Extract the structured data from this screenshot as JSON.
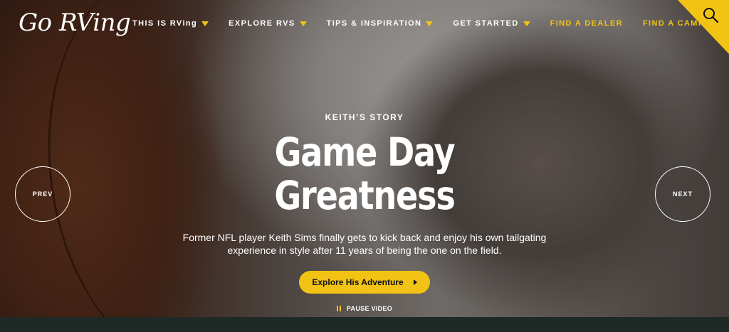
{
  "brand": {
    "logo_text": "Go RVing"
  },
  "nav": {
    "items": [
      {
        "label": "THIS IS RVing",
        "has_dropdown": true
      },
      {
        "label": "EXPLORE RVS",
        "has_dropdown": true
      },
      {
        "label": "TIPS & INSPIRATION",
        "has_dropdown": true
      },
      {
        "label": "GET STARTED",
        "has_dropdown": true
      },
      {
        "label": "FIND A DEALER",
        "has_dropdown": false
      },
      {
        "label": "FIND A CAMPGROUND",
        "has_dropdown": false
      }
    ]
  },
  "search": {
    "icon": "search-icon"
  },
  "hero": {
    "eyebrow": "KEITH’S STORY",
    "headline": "Game Day Greatness",
    "description": "Former NFL player Keith Sims finally gets to kick back and enjoy his own tailgating experience in style after 11 years of being the one on the field.",
    "cta_label": "Explore His Adventure",
    "pause_label": "PAUSE VIDEO"
  },
  "carousel": {
    "prev_label": "PREV",
    "next_label": "NEXT"
  },
  "colors": {
    "accent": "#f2c314",
    "footer_bar": "#1f2a27"
  }
}
